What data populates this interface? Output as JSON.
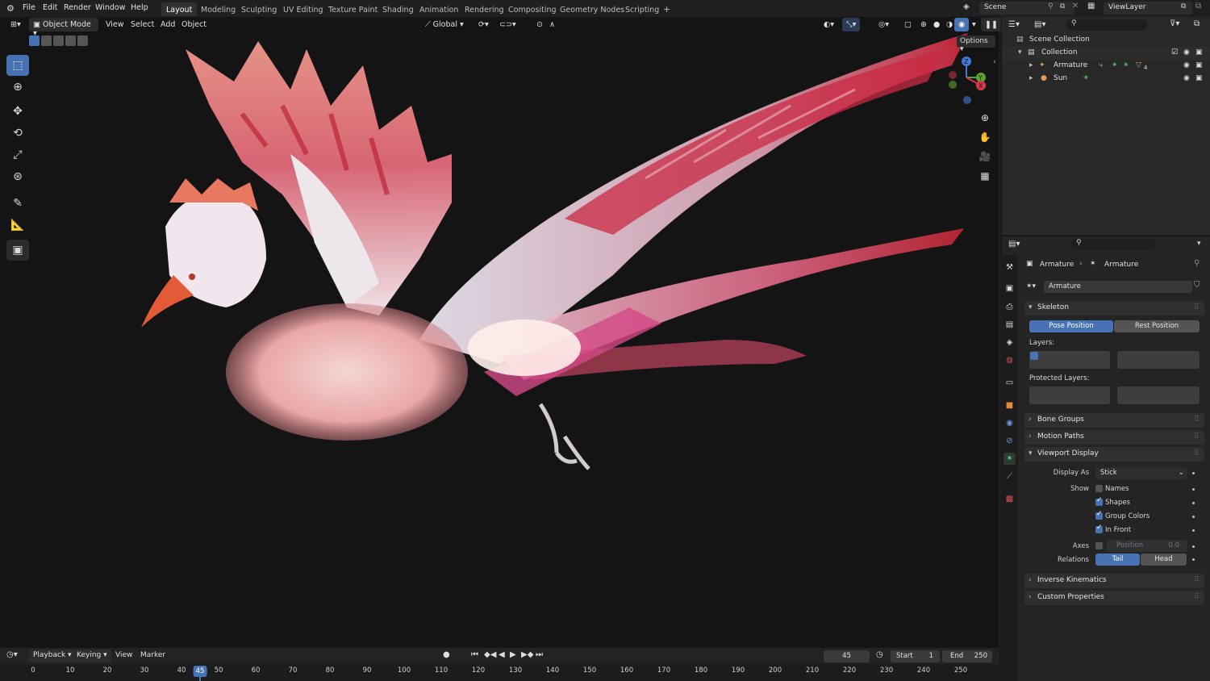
{
  "menu": [
    "File",
    "Edit",
    "Render",
    "Window",
    "Help"
  ],
  "workspaces": [
    "Layout",
    "Modeling",
    "Sculpting",
    "UV Editing",
    "Texture Paint",
    "Shading",
    "Animation",
    "Rendering",
    "Compositing",
    "Geometry Nodes",
    "Scripting"
  ],
  "active_workspace": "Layout",
  "add_workspace": "+",
  "scene": {
    "label": "Scene",
    "view_layer": "ViewLayer"
  },
  "viewport_header": {
    "mode": "Object Mode",
    "menus": [
      "View",
      "Select",
      "Add",
      "Object"
    ],
    "orientation": "Global",
    "options": "Options"
  },
  "gizmo": {
    "x": "X",
    "y": "Y",
    "z": "Z"
  },
  "outliner": {
    "root": "Scene Collection",
    "collection": "Collection",
    "items": [
      {
        "name": "Armature",
        "badge": "4"
      },
      {
        "name": "Sun"
      }
    ]
  },
  "properties": {
    "breadcrumb": [
      "Armature",
      "Armature"
    ],
    "datablock": "Armature",
    "skeleton": {
      "title": "Skeleton",
      "pose_position": "Pose Position",
      "rest_position": "Rest Position",
      "layers_label": "Layers:",
      "protected_layers_label": "Protected Layers:"
    },
    "bone_groups": "Bone Groups",
    "motion_paths": "Motion Paths",
    "viewport_display": {
      "title": "Viewport Display",
      "display_as_label": "Display As",
      "display_as_value": "Stick",
      "show_label": "Show",
      "show": [
        {
          "label": "Names",
          "checked": false
        },
        {
          "label": "Shapes",
          "checked": true
        },
        {
          "label": "Group Colors",
          "checked": true
        },
        {
          "label": "In Front",
          "checked": true
        }
      ],
      "axes_label": "Axes",
      "axes_position_label": "Position",
      "axes_position_value": "0.0",
      "relations_label": "Relations",
      "relations_tail": "Tail",
      "relations_head": "Head"
    },
    "inverse_kinematics": "Inverse Kinematics",
    "custom_properties": "Custom Properties"
  },
  "timeline": {
    "menus": [
      "Playback",
      "Keying",
      "View",
      "Marker"
    ],
    "current_frame": "45",
    "start_label": "Start",
    "start": "1",
    "end_label": "End",
    "end": "250",
    "ruler": [
      "0",
      "10",
      "20",
      "30",
      "40",
      "45",
      "50",
      "60",
      "70",
      "80",
      "90",
      "100",
      "110",
      "120",
      "130",
      "140",
      "150",
      "160",
      "170",
      "180",
      "190",
      "200",
      "210",
      "220",
      "230",
      "240",
      "250"
    ]
  },
  "colors": {
    "accent": "#4772b3",
    "viewport_bg": "#141414",
    "panel_bg": "#242424",
    "outliner_bg": "#282828",
    "active_tab": "#303030"
  }
}
